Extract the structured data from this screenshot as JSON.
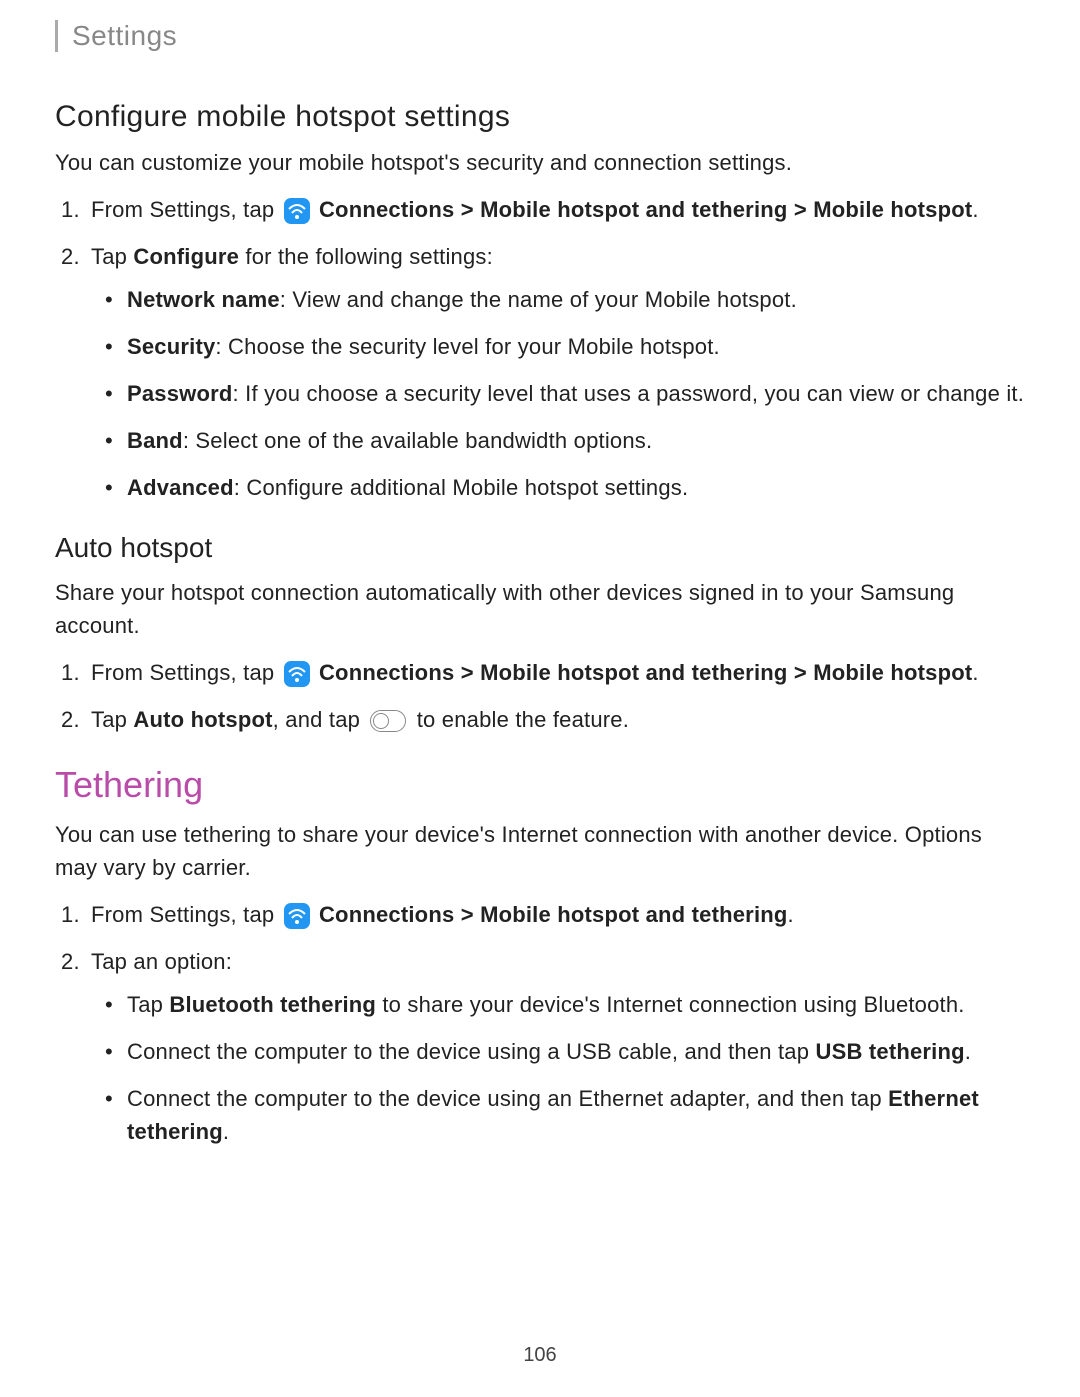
{
  "header": {
    "title": "Settings"
  },
  "section1": {
    "heading": "Configure mobile hotspot settings",
    "intro": "You can customize your mobile hotspot's security and connection settings.",
    "step1_prefix": "From Settings, tap ",
    "step1_bold1": "Connections > Mobile hotspot and tethering > Mobile hotspot",
    "step1_suffix": ".",
    "step2_prefix": "Tap ",
    "step2_bold": "Configure",
    "step2_suffix": " for the following settings:",
    "bullet1_label": "Network name",
    "bullet1_text": ": View and change the name of your Mobile hotspot.",
    "bullet2_label": "Security",
    "bullet2_text": ": Choose the security level for your Mobile hotspot.",
    "bullet3_label": "Password",
    "bullet3_text": ": If you choose a security level that uses a password, you can view or change it.",
    "bullet4_label": "Band",
    "bullet4_text": ": Select one of the available bandwidth options.",
    "bullet5_label": "Advanced",
    "bullet5_text": ": Configure additional Mobile hotspot settings."
  },
  "section2": {
    "heading": "Auto hotspot",
    "intro": "Share your hotspot connection automatically with other devices signed in to your Samsung account.",
    "step1_prefix": "From Settings, tap ",
    "step1_bold": "Connections > Mobile hotspot and tethering > Mobile hotspot",
    "step1_suffix": ".",
    "step2_prefix": "Tap ",
    "step2_bold": "Auto hotspot",
    "step2_mid": ", and tap ",
    "step2_suffix": " to enable the feature."
  },
  "section3": {
    "heading": "Tethering",
    "intro": "You can use tethering to share your device's Internet connection with another device. Options may vary by carrier.",
    "step1_prefix": "From Settings, tap ",
    "step1_bold": "Connections > Mobile hotspot and tethering",
    "step1_suffix": ".",
    "step2": "Tap an option:",
    "bullet1_prefix": "Tap ",
    "bullet1_bold": "Bluetooth tethering",
    "bullet1_suffix": " to share your device's Internet connection using Bluetooth.",
    "bullet2_prefix": "Connect the computer to the device using a USB cable, and then tap ",
    "bullet2_bold": "USB tethering",
    "bullet2_suffix": ".",
    "bullet3_prefix": "Connect the computer to the device using an Ethernet adapter, and then tap ",
    "bullet3_bold": "Ethernet tethering",
    "bullet3_suffix": "."
  },
  "pageNumber": "106"
}
